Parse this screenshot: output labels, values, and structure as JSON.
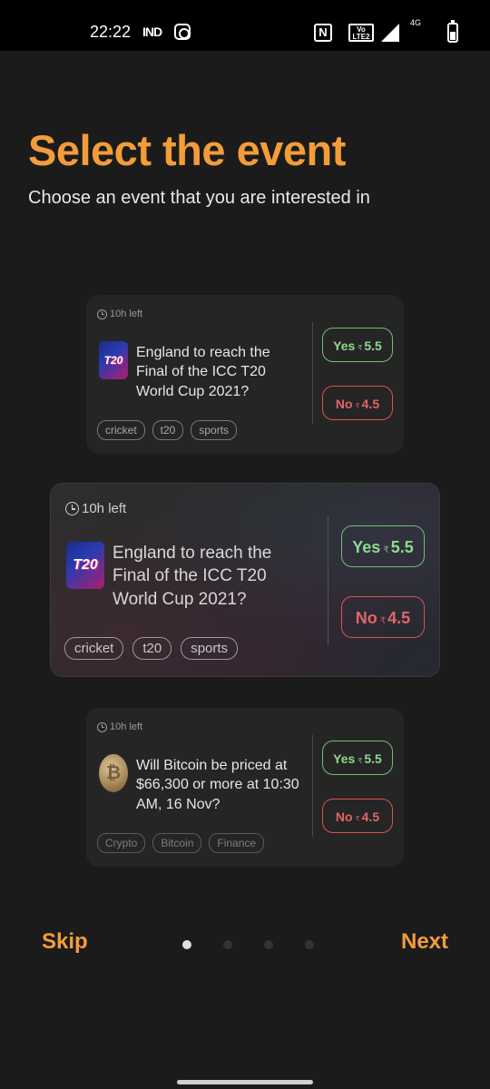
{
  "status_bar": {
    "time": "22:22",
    "carrier_icon_text": "IND",
    "nfc_text": "N",
    "volte_text": "Vo LTE2",
    "network": "4G"
  },
  "header": {
    "title": "Select the event",
    "subtitle": "Choose an event that you are interested in"
  },
  "cards": [
    {
      "time_left": "10h left",
      "question": "England to reach the Final of the ICC T20 World Cup 2021?",
      "thumb_text": "T20",
      "yes_label": "Yes",
      "yes_price": "5.5",
      "no_label": "No",
      "no_price": "4.5",
      "currency": "₹",
      "tags": [
        "cricket",
        "t20",
        "sports"
      ]
    },
    {
      "time_left": "10h left",
      "question": "England to reach the Final of the ICC T20 World Cup 2021?",
      "thumb_text": "T20",
      "yes_label": "Yes",
      "yes_price": "5.5",
      "no_label": "No",
      "no_price": "4.5",
      "currency": "₹",
      "tags": [
        "cricket",
        "t20",
        "sports"
      ]
    },
    {
      "time_left": "10h left",
      "question": "Will Bitcoin be priced at $66,300 or more at 10:30 AM, 16 Nov?",
      "thumb_text": "₿",
      "yes_label": "Yes",
      "yes_price": "5.5",
      "no_label": "No",
      "no_price": "4.5",
      "currency": "₹",
      "tags": [
        "Crypto",
        "Bitcoin",
        "Finance"
      ]
    }
  ],
  "nav": {
    "skip_label": "Skip",
    "next_label": "Next",
    "page_count": 4,
    "active_page": 1
  },
  "colors": {
    "accent": "#f39c3a",
    "yes": "#8fd98f",
    "no": "#e06666",
    "background": "#1b1b1b"
  }
}
